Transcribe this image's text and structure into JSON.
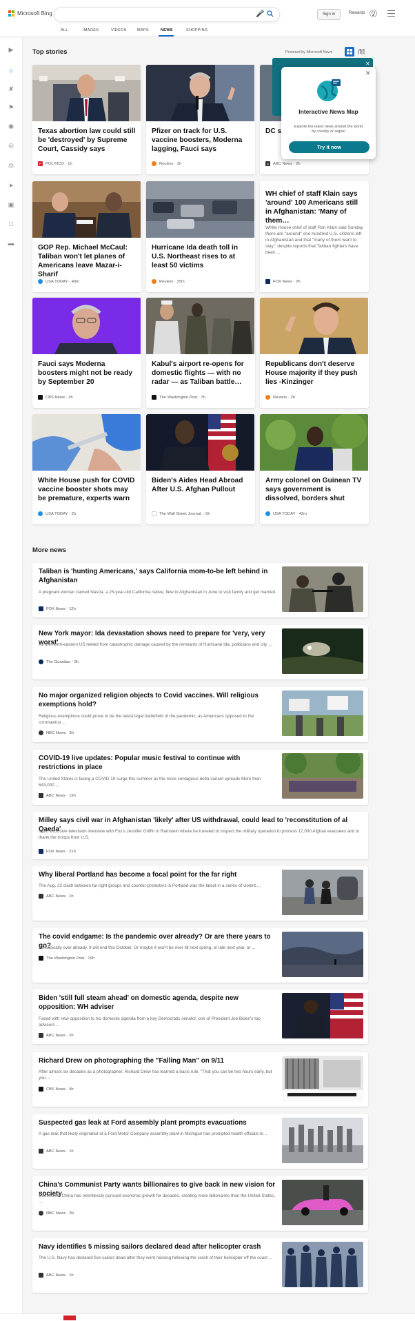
{
  "header": {
    "logo_text": "Microsoft Bing",
    "search_placeholder": "",
    "signin_label": "Sign in",
    "rewards_label": "Rewards"
  },
  "tabs": [
    "ALL",
    "IMAGES",
    "VIDEOS",
    "MAPS",
    "NEWS",
    "SHOPPING"
  ],
  "active_tab": "NEWS",
  "top_stories": {
    "heading": "Top stories",
    "powered_by": "Powered by Microsoft News",
    "cards": [
      {
        "title": "Texas abortion law could still be 'destroyed' by Supreme Court, Cassidy says",
        "source": "POLITICO",
        "time": "1h"
      },
      {
        "title": "Pfizer on track for U.S. vaccine boosters, Moderna lagging, Fauci says",
        "source": "Reuters",
        "time": "1h"
      },
      {
        "title": "DC sl… woun…",
        "source": "ABC News",
        "time": "2h"
      },
      {
        "title": "GOP Rep. Michael McCaul: Taliban won't let planes of Americans leave Mazar-i-Sharif",
        "source": "USA TODAY",
        "time": "40m"
      },
      {
        "title": "Hurricane Ida death toll in U.S. Northeast rises to at least 50 victims",
        "source": "Reuters",
        "time": "35m"
      },
      {
        "title": "WH chief of staff Klain says 'around' 100 Americans still in Afghanistan: 'Many of them…",
        "snippet": "White House chief of staff Ron Klain said Sunday there are \"around\" one hundred U.S. citizens left in Afghanistan and that \"many of them want to stay,\" despite reports that Taliban fighters have been ...",
        "source": "FOX News",
        "time": "2h"
      },
      {
        "title": "Fauci says Moderna boosters might not be ready by September 20",
        "source": "CBS News",
        "time": "2h"
      },
      {
        "title": "Kabul's airport re-opens for domestic flights — with no radar — as Taliban battle…",
        "source": "The Washington Post",
        "time": "7h"
      },
      {
        "title": "Republicans don't deserve House majority if they push lies -Kinzinger",
        "source": "Reuters",
        "time": "2h"
      },
      {
        "title": "White House push for COVID vaccine booster shots may be premature, experts warn",
        "source": "USA TODAY",
        "time": "2h"
      },
      {
        "title": "Biden's Aides Head Abroad After U.S. Afghan Pullout",
        "source": "The Wall Street Journal.",
        "time": "5h"
      },
      {
        "title": "Army colonel on Guinean TV says government is dissolved, borders shut",
        "source": "USA TODAY",
        "time": "42m"
      }
    ]
  },
  "popup": {
    "title": "Interactive News Map",
    "description": "Explore the latest news around the world by country or region",
    "button": "Try it now"
  },
  "more_news": {
    "heading": "More news",
    "items": [
      {
        "title": "Taliban is 'hunting Americans,' says California mom-to-be left behind in Afghanistan",
        "snippet": "A pregnant woman named Nasria, a 25-year-old California native, flew to Afghanistan in June to visit family and get married.",
        "source": "FOX News",
        "time": "12h"
      },
      {
        "title": "New York mayor: Ida devastation shows need to prepare for 'very, very worst'",
        "snippet": "As the north-eastern US reeled from catastrophic damage caused by the remnants of Hurricane Ida, politicians and city ...",
        "source": "The Guardian",
        "time": "9h"
      },
      {
        "title": "No major organized religion objects to Covid vaccines. Will religious exemptions hold?",
        "snippet": "Religious exemptions could prove to be the latest legal battlefield of the pandemic, as Americans opposed to the coronavirus ...",
        "source": "NBC News",
        "time": "9h"
      },
      {
        "title": "COVID-19 live updates: Popular music festival to continue with restrictions in place",
        "snippet": "The United States is facing a COVID-19 surge this summer as the more contagious delta variant spreads More than 643,000 ...",
        "source": "ABC News",
        "time": "19h"
      },
      {
        "title": "Milley says civil war in Afghanistan 'likely' after US withdrawal, could lead to 'reconstitution of al Qaeda'",
        "snippet": "In an exclusive television interview with Fox's Jennifer Griffin in Ramstein where he traveled to inspect the military operation to process 17,000 Afghan evacuees and to thank the troops from U.S.",
        "source": "FOX News",
        "time": "21h"
      },
      {
        "title": "Why liberal Portland has become a focal point for the far right",
        "snippet": "The Aug. 22 clash between far-right groups and counter-protesters in Portland was the latest in a series of violent ...",
        "source": "ABC News",
        "time": "1h"
      },
      {
        "title": "The covid endgame: Is the pandemic over already? Or are there years to go?",
        "snippet": "It's basically over already. It will end this October. Or maybe it won't be over till next spring, or late next year, or ...",
        "source": "The Washington Post",
        "time": "19h"
      },
      {
        "title": "Biden 'still full steam ahead' on domestic agenda, despite new opposition: WH adviser",
        "snippet": "Faced with new opposition to his domestic agenda from a key Democratic senator, one of President Joe Biden's top advisers ...",
        "source": "ABC News",
        "time": "2h"
      },
      {
        "title": "Richard Drew on photographing the \"Falling Man\" on 9/11",
        "snippet": "After almost six decades as a photographer, Richard Drew has learned a basic rule: \"That you can be two hours early, but you ...",
        "source": "CBS News",
        "time": "4h"
      },
      {
        "title": "Suspected gas leak at Ford assembly plant prompts evacuations",
        "snippet": "A gas leak that likely originated at a Ford Motor Company assembly plant in Michigan has prompted health officials to ...",
        "source": "ABC News",
        "time": "1h"
      },
      {
        "title": "China's Communist Party wants billionaires to give back in new vision for society",
        "snippet": "Communist China has relentlessly pursued economic growth for decades, creating more billionaires than the United States, ...",
        "source": "NBC News",
        "time": "9h"
      },
      {
        "title": "Navy identifies 5 missing sailors declared dead after helicopter crash",
        "snippet": "The U.S. Navy has declared five sailors dead after they went missing following the crash of their helicopter off the coast ...",
        "source": "ABC News",
        "time": "1h"
      }
    ]
  }
}
